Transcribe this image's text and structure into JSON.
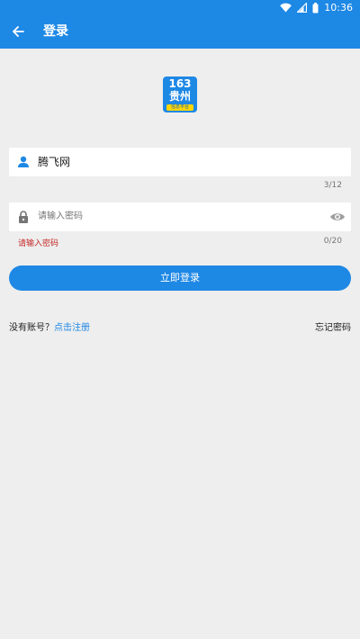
{
  "status_bar": {
    "time": "10:36",
    "icons": [
      "wifi-icon",
      "signal-icon",
      "battery-icon"
    ]
  },
  "app_bar": {
    "title": "登录",
    "back_icon": "arrow-left-icon"
  },
  "logo": {
    "number": "163",
    "city": "贵州",
    "tagline": "信息平台"
  },
  "username": {
    "value": "腾飞网",
    "counter": "3/12",
    "icon": "person-icon"
  },
  "password": {
    "placeholder": "请输入密码",
    "counter": "0/20",
    "error": "请输入密码",
    "icon": "lock-icon",
    "toggle_icon": "eye-icon"
  },
  "login_button": {
    "label": "立即登录"
  },
  "footer": {
    "no_account_text": "没有账号？",
    "register_link": "点击注册",
    "forgot_link": "忘记密码"
  },
  "colors": {
    "primary": "#1e88e5",
    "background": "#eeeeee",
    "error": "#c62828"
  }
}
